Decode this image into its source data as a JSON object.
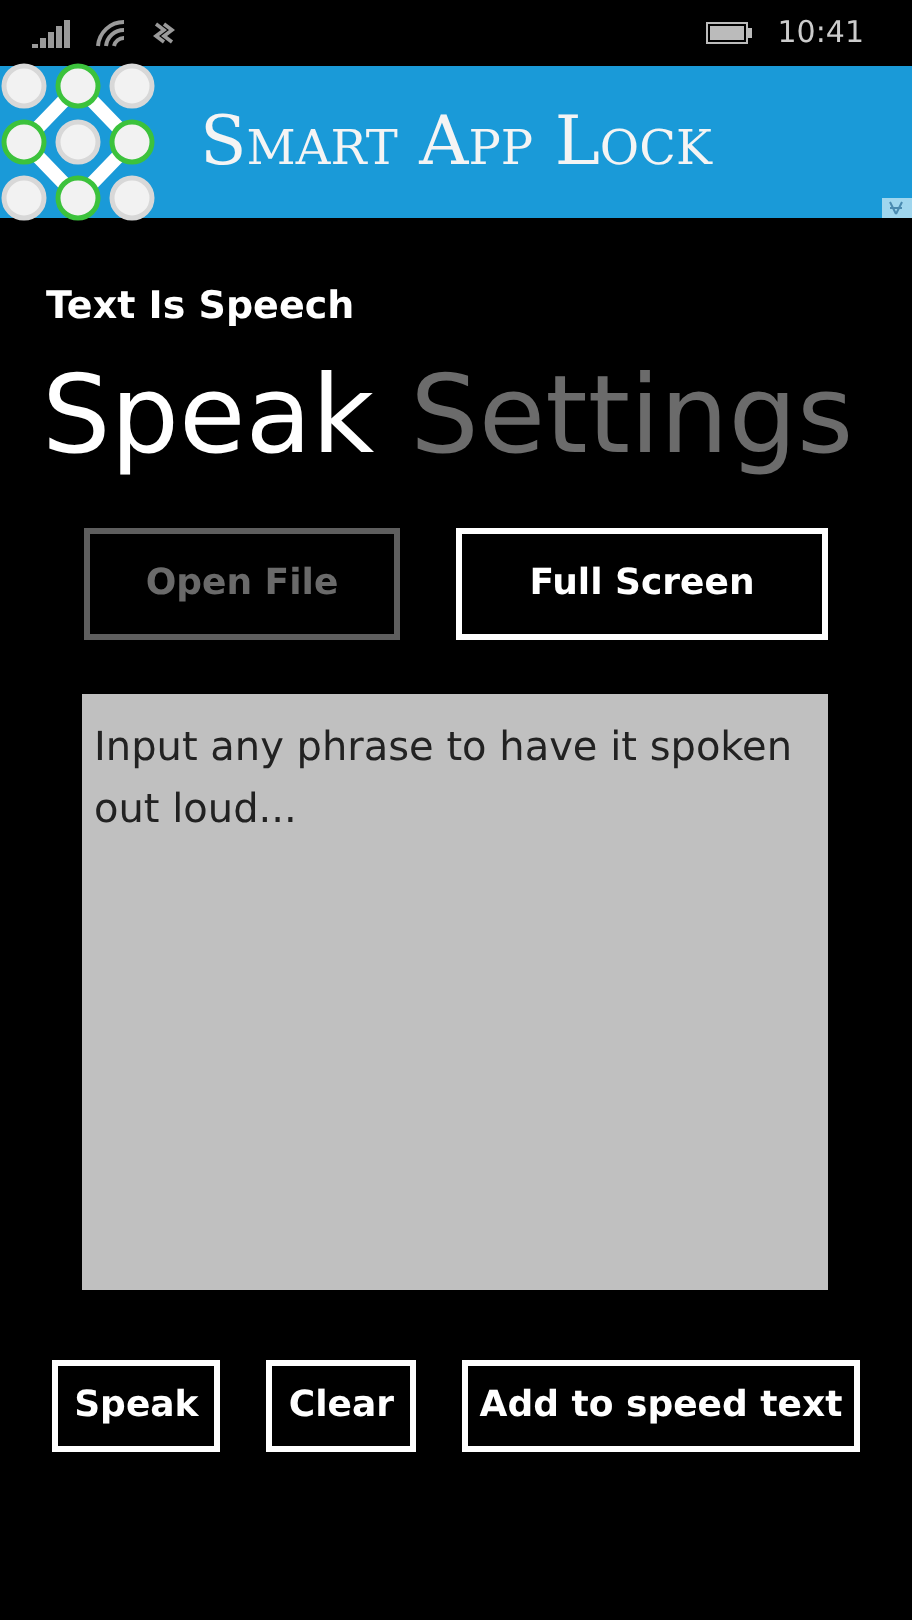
{
  "status_bar": {
    "time": "10:41"
  },
  "ad": {
    "title": "Smart App Lock"
  },
  "app_title": "Text Is Speech",
  "pivot": [
    {
      "label": "Speak",
      "selected": true
    },
    {
      "label": "Settings",
      "selected": false
    }
  ],
  "top_buttons": [
    {
      "label": "Open File",
      "disabled": true
    },
    {
      "label": "Full Screen",
      "disabled": false
    }
  ],
  "input": {
    "placeholder": "Input any phrase to have it spoken out loud..."
  },
  "bottom_buttons": [
    {
      "label": "Speak"
    },
    {
      "label": "Clear"
    },
    {
      "label": "Add to speed text"
    }
  ]
}
